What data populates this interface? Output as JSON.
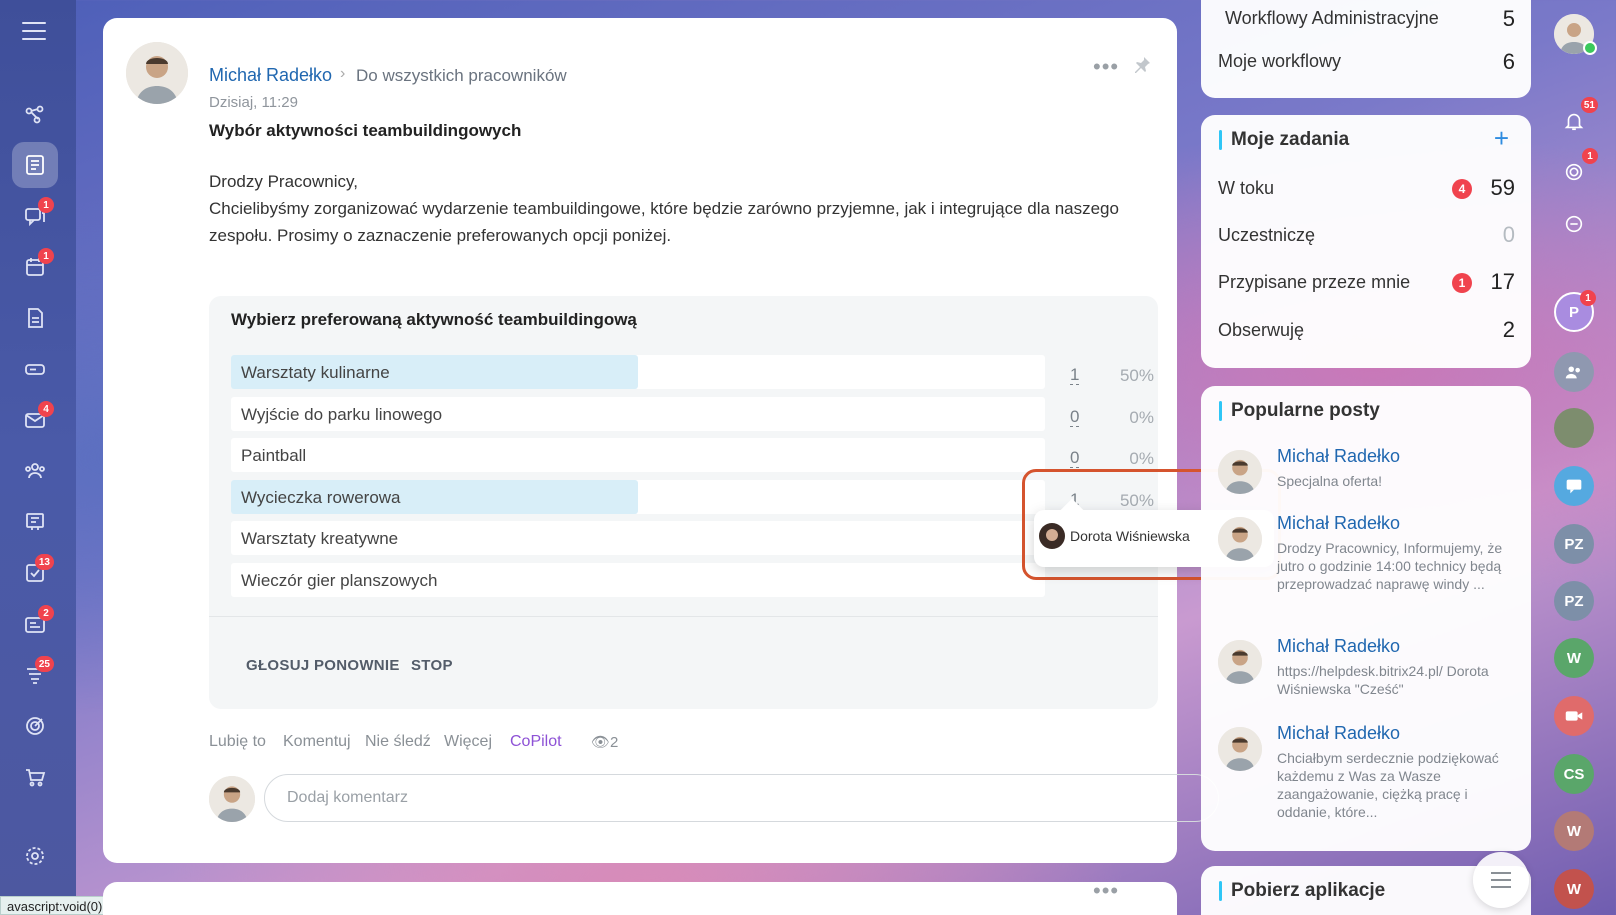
{
  "left_nav": {
    "items": [
      {
        "name": "nav-collab-icon",
        "badge": ""
      },
      {
        "name": "nav-feed-icon",
        "badge": ""
      },
      {
        "name": "nav-chat-icon",
        "badge": "1"
      },
      {
        "name": "nav-calendar-icon",
        "badge": "1"
      },
      {
        "name": "nav-docs-icon",
        "badge": ""
      },
      {
        "name": "nav-drive-icon",
        "badge": ""
      },
      {
        "name": "nav-mail-icon",
        "badge": "4"
      },
      {
        "name": "nav-groups-icon",
        "badge": ""
      },
      {
        "name": "nav-board-icon",
        "badge": ""
      },
      {
        "name": "nav-tasks-icon",
        "badge": "13"
      },
      {
        "name": "nav-crm-icon",
        "badge": "2"
      },
      {
        "name": "nav-automation-icon",
        "badge": "25"
      },
      {
        "name": "nav-goals-icon",
        "badge": ""
      },
      {
        "name": "nav-shop-icon",
        "badge": ""
      }
    ],
    "status_text": "avascript:void(0);"
  },
  "post": {
    "author": "Michał Radełko",
    "audience": "Do wszystkich pracowników",
    "date": "Dzisiaj, 11:29",
    "title": "Wybór aktywności teambuildingowych",
    "body_line1": "Drodzy Pracownicy,",
    "body_line2": "Chcielibyśmy zorganizować wydarzenie teambuildingowe, które będzie zarówno przyjemne, jak i integrujące dla naszego zespołu. Prosimy o zaznaczenie preferowanych opcji poniżej.",
    "more_label": "•••"
  },
  "poll": {
    "question": "Wybierz preferowaną aktywność teambuildingową",
    "options": [
      {
        "label": "Warsztaty kulinarne",
        "count": "1",
        "percent": "50%",
        "fraction": 0.5
      },
      {
        "label": "Wyjście do parku linowego",
        "count": "0",
        "percent": "0%",
        "fraction": 0
      },
      {
        "label": "Paintball",
        "count": "0",
        "percent": "0%",
        "fraction": 0
      },
      {
        "label": "Wycieczka rowerowa",
        "count": "1",
        "percent": "50%",
        "fraction": 0.5
      },
      {
        "label": "Warsztaty kreatywne",
        "count": "",
        "percent": "",
        "fraction": 0
      },
      {
        "label": "Wieczór gier planszowych",
        "count": "",
        "percent": "",
        "fraction": 0
      }
    ],
    "vote_again": "GŁOSUJ PONOWNIE",
    "stop": "STOP",
    "voters_popup": {
      "voter": "Dorota Wiśniewska"
    }
  },
  "post_actions": {
    "like": "Lubię to",
    "comment": "Komentuj",
    "unfollow": "Nie śledź",
    "more": "Więcej",
    "copilot": "CoPilot",
    "views": "2"
  },
  "comment": {
    "placeholder": "Dodaj komentarz"
  },
  "workflows": {
    "rows": [
      {
        "label": "Workflowy Administracyjne",
        "value": "5"
      },
      {
        "label": "Moje workflowy",
        "value": "6"
      }
    ]
  },
  "tasks": {
    "title": "Moje zadania",
    "rows": [
      {
        "label": "W toku",
        "badge": "4",
        "value": "59"
      },
      {
        "label": "Uczestniczę",
        "badge": "",
        "value": "0"
      },
      {
        "label": "Przypisane przeze mnie",
        "badge": "1",
        "value": "17"
      },
      {
        "label": "Obserwuję",
        "badge": "",
        "value": "2"
      }
    ]
  },
  "popular": {
    "title": "Popularne posty",
    "items": [
      {
        "author": "Michał Radełko",
        "text": "Specjalna oferta!"
      },
      {
        "author": "Michał Radełko",
        "text": "Drodzy Pracownicy, Informujemy, że jutro o godzinie 14:00 technicy będą przeprowadzać naprawę windy ..."
      },
      {
        "author": "Michał Radełko",
        "text": "https://helpdesk.bitrix24.pl/ Dorota Wiśniewska \"Cześć\""
      },
      {
        "author": "Michał Radełko",
        "text": "Chciałbym serdecznie podziękować każdemu z Was za Wasze zaangażowanie, ciężką pracę i oddanie, które..."
      }
    ]
  },
  "apps": {
    "title": "Pobierz aplikacje"
  },
  "right_bar": {
    "notifications_badge": "51",
    "goals_badge": "1",
    "user_p_initial": "P",
    "user_p_badge": "1",
    "pz1": "PZ",
    "pz2": "PZ",
    "w1": "W",
    "cs": "CS",
    "w2": "W",
    "w3": "W"
  },
  "colors": {
    "accent_blue": "#2067b0",
    "badge_red": "#f0434e",
    "poll_fill": "#d8eef8",
    "copilot_purple": "#8e52d6",
    "highlight_orange": "#d5542e"
  }
}
